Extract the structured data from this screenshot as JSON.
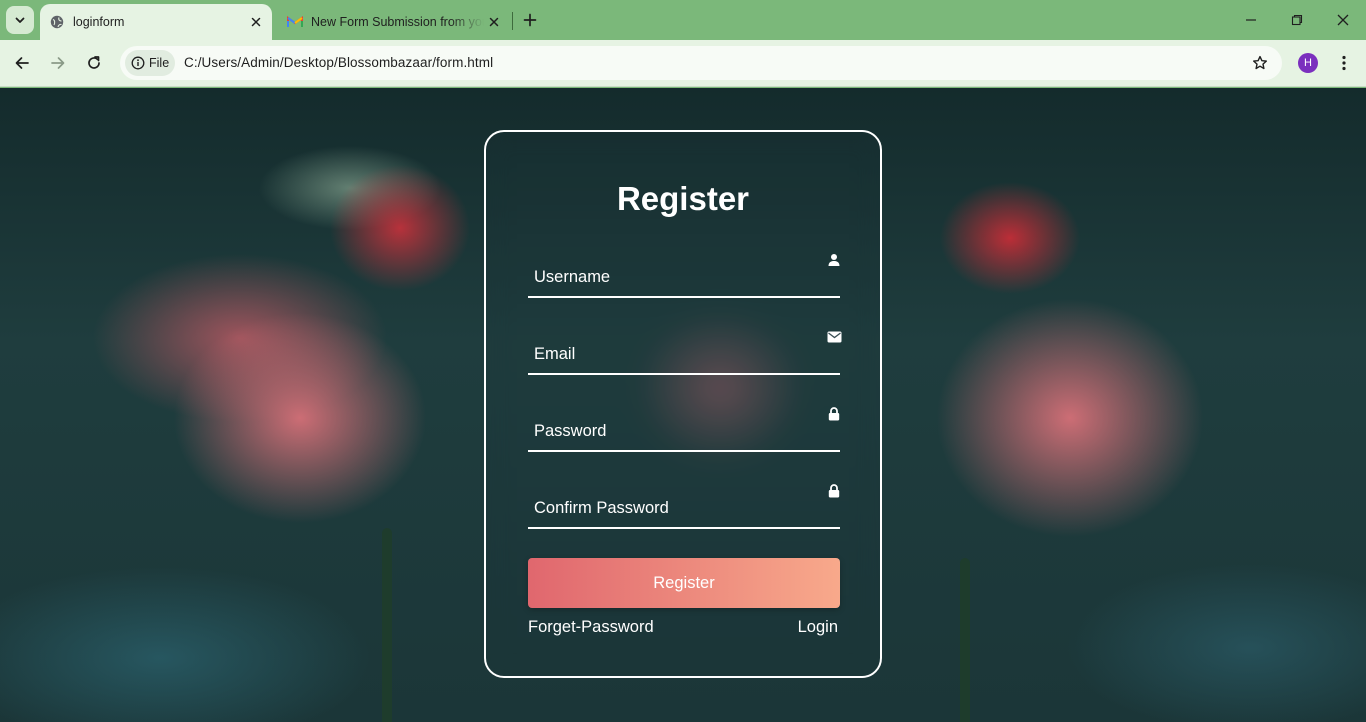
{
  "browser": {
    "tabs": [
      {
        "title": "loginform",
        "active": true,
        "favicon": "globe-icon"
      },
      {
        "title": "New Form Submission from your",
        "active": false,
        "favicon": "gmail-icon"
      }
    ],
    "address": {
      "chip_label": "File",
      "url": "C:/Users/Admin/Desktop/Blossombazaar/form.html"
    },
    "profile_initial": "H",
    "colors": {
      "frame": "#7bb87a",
      "toolbar": "#e6f3e3",
      "avatar": "#7b2fbe"
    }
  },
  "form": {
    "title": "Register",
    "fields": [
      {
        "placeholder": "Username",
        "icon": "user-icon"
      },
      {
        "placeholder": "Email",
        "icon": "envelope-icon"
      },
      {
        "placeholder": "Password",
        "icon": "lock-icon"
      },
      {
        "placeholder": "Confirm Password",
        "icon": "lock-icon"
      }
    ],
    "submit_label": "Register",
    "forget_password_label": "Forget-Password",
    "login_label": "Login",
    "colors": {
      "button_start": "#e0676e",
      "button_end": "#f8a98b"
    }
  }
}
